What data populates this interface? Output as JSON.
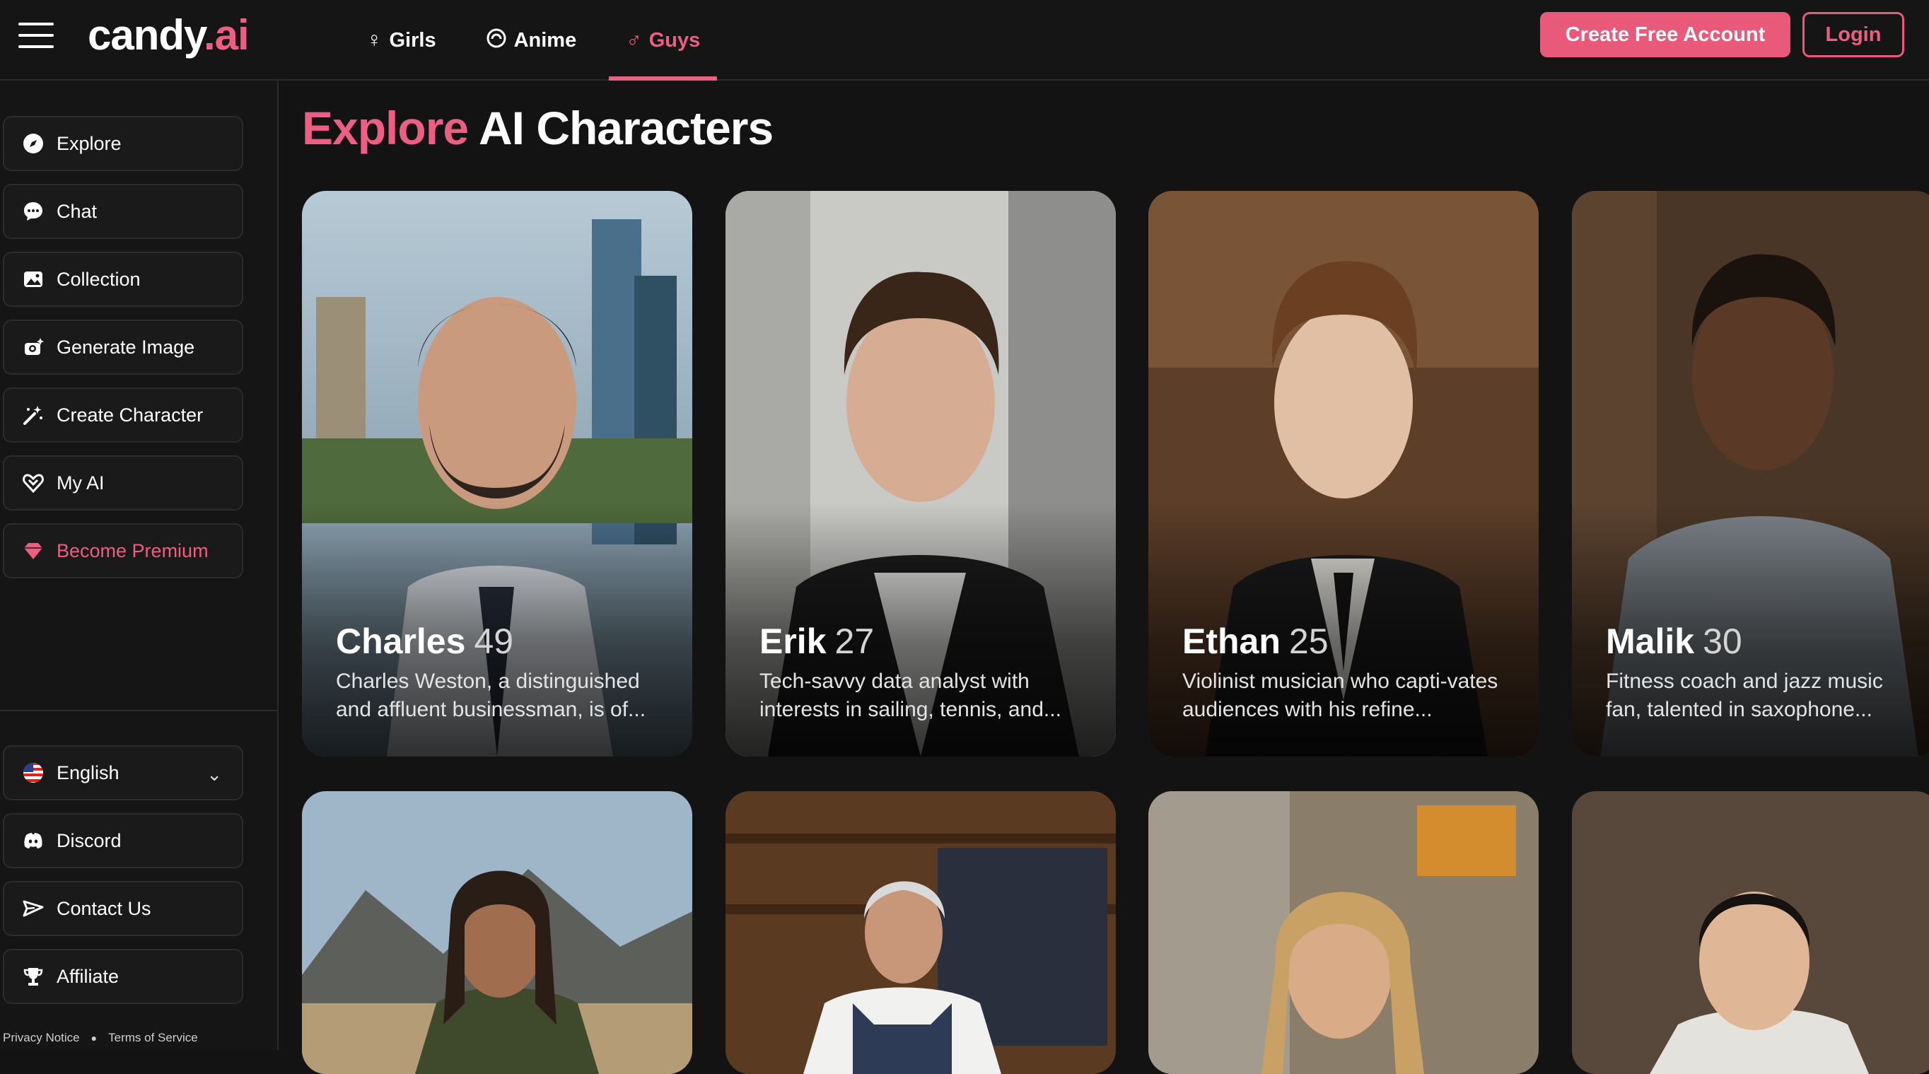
{
  "header": {
    "logo_main": "candy",
    "logo_accent": ".ai",
    "nav": [
      {
        "label": "Girls",
        "icon": "female-icon"
      },
      {
        "label": "Anime",
        "icon": "anime-icon"
      },
      {
        "label": "Guys",
        "icon": "male-icon",
        "active": true
      }
    ],
    "create_account_label": "Create Free Account",
    "login_label": "Login"
  },
  "sidebar": {
    "items": [
      {
        "label": "Explore",
        "icon": "compass-icon"
      },
      {
        "label": "Chat",
        "icon": "chat-bubble-icon"
      },
      {
        "label": "Collection",
        "icon": "image-gallery-icon"
      },
      {
        "label": "Generate Image",
        "icon": "camera-sparkle-icon"
      },
      {
        "label": "Create Character",
        "icon": "magic-wand-icon"
      },
      {
        "label": "My AI",
        "icon": "heart-hands-icon"
      },
      {
        "label": "Become Premium",
        "icon": "diamond-icon"
      }
    ],
    "language": {
      "label": "English",
      "icon": "us-flag-icon"
    },
    "bottom_items": [
      {
        "label": "Discord",
        "icon": "discord-icon"
      },
      {
        "label": "Contact Us",
        "icon": "mail-send-icon"
      },
      {
        "label": "Affiliate",
        "icon": "trophy-icon"
      }
    ],
    "footer": {
      "privacy": "Privacy Notice",
      "terms": "Terms of Service"
    }
  },
  "main": {
    "title_accent": "Explore",
    "title_rest": " AI Characters",
    "characters": [
      {
        "name": "Charles",
        "age": "49",
        "description": "Charles Weston, a distinguished and affluent businessman, is of..."
      },
      {
        "name": "Erik",
        "age": "27",
        "description": "Tech-savvy data analyst with interests in sailing, tennis, and..."
      },
      {
        "name": "Ethan",
        "age": "25",
        "description": "Violinist musician who capti-vates audiences with his refine..."
      },
      {
        "name": "Malik",
        "age": "30",
        "description": "Fitness coach and jazz music fan, talented in saxophone..."
      }
    ]
  },
  "colors": {
    "accent": "#ec5f83",
    "background": "#131313",
    "panel": "#1a1a1a"
  }
}
